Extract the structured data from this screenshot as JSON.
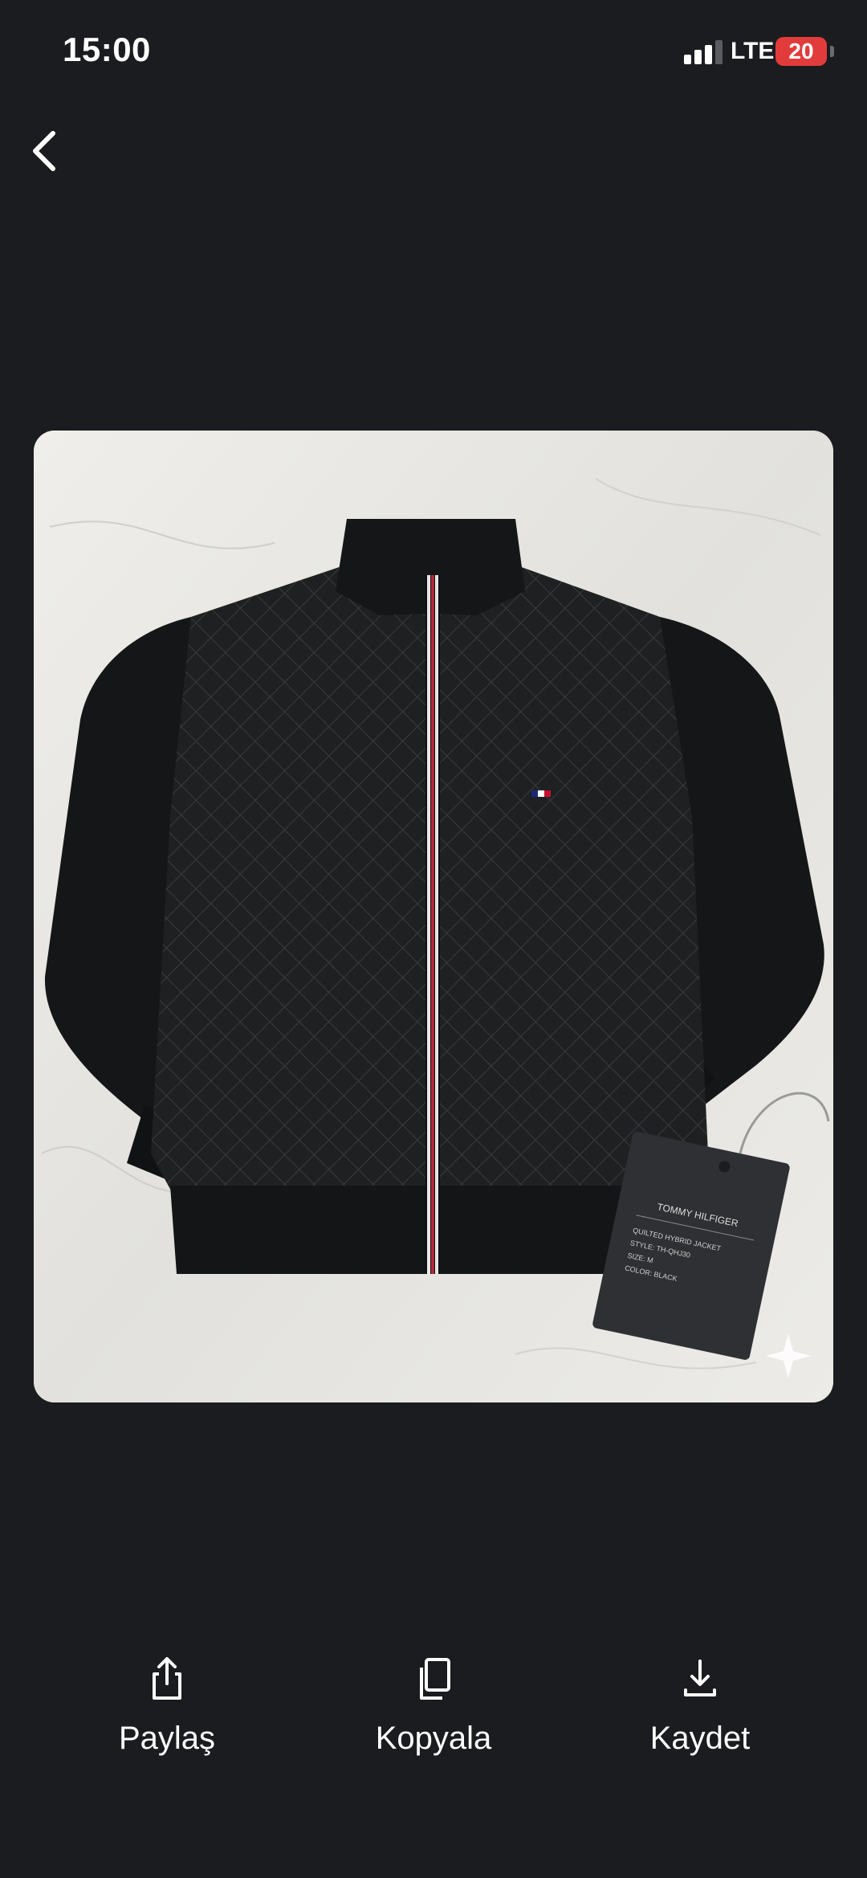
{
  "status_bar": {
    "time": "15:00",
    "network": "LTE",
    "battery_level": "20",
    "signal_bars_active": 3,
    "signal_bars_total": 4,
    "battery_color": "#e23b3b"
  },
  "nav": {
    "back_icon": "chevron-left-icon"
  },
  "image": {
    "subject": "black-quilted-jacket-photo",
    "tag": {
      "brand": "TOMMY HILFIGER",
      "lines": [
        "QUILTED HYBRID JACKET",
        "STYLE: TH-QHJ30",
        "SIZE: M",
        "COLOR: BLACK"
      ]
    },
    "sparkle_icon": "sparkle-icon"
  },
  "actions": [
    {
      "label": "Paylaş",
      "icon": "share-icon"
    },
    {
      "label": "Kopyala",
      "icon": "copy-icon"
    },
    {
      "label": "Kaydet",
      "icon": "download-icon"
    }
  ],
  "colors": {
    "background": "#1b1c1f",
    "text": "#ffffff"
  }
}
